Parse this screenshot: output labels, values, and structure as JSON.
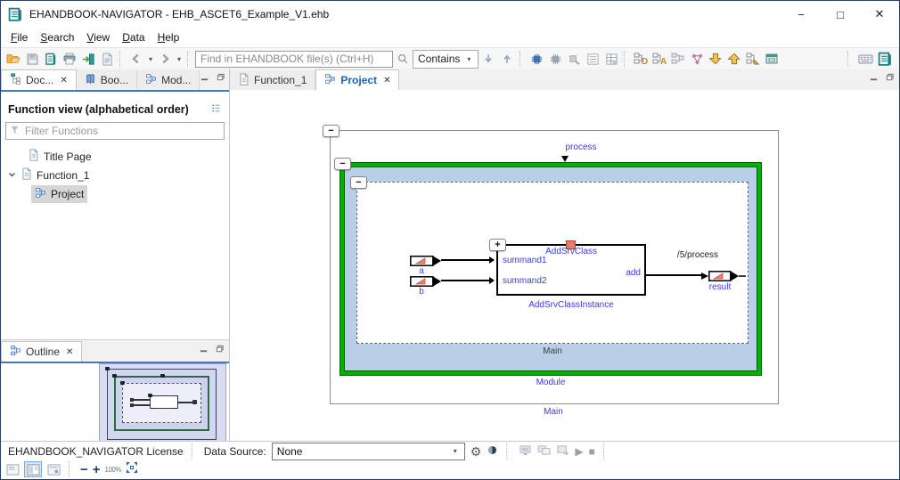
{
  "window": {
    "title": "EHANDBOOK-NAVIGATOR - EHB_ASCET6_Example_V1.ehb"
  },
  "icons": {
    "minimize": "−",
    "maximize": "□",
    "close": "✕",
    "tab_close": "✕",
    "caret_down": "▾",
    "collapse": "−",
    "expand": "+",
    "gear": "⚙",
    "play": "▶",
    "stop": "■",
    "minus": "−",
    "plus": "+"
  },
  "menu": {
    "items": [
      "File",
      "Search",
      "View",
      "Data",
      "Help"
    ]
  },
  "toolbar": {
    "find_placeholder": "Find in EHANDBOOK file(s) (Ctrl+H)",
    "match_mode": "Contains"
  },
  "left_panel": {
    "tabs": [
      {
        "label": "Doc..."
      },
      {
        "label": "Boo..."
      },
      {
        "label": "Mod..."
      }
    ],
    "function_view": {
      "title": "Function view (alphabetical order)",
      "filter_placeholder": "Filter Functions",
      "tree": [
        {
          "label": "Title Page"
        },
        {
          "label": "Function_1"
        },
        {
          "label": "Project"
        }
      ]
    },
    "outline": {
      "title": "Outline"
    }
  },
  "main": {
    "tabs": [
      {
        "label": "Function_1"
      },
      {
        "label": "Project"
      }
    ]
  },
  "diagram": {
    "top_port_label": "process",
    "root_label": "Main",
    "module_label": "Module",
    "inner_label": "Main",
    "wire_label": "/5/process",
    "port_a": "a",
    "port_b": "b",
    "port_result": "result",
    "block": {
      "class_name": "AddSrvClass",
      "instance_name": "AddSrvClassInstance",
      "input1": "summand1",
      "input2": "summand2",
      "output": "add"
    },
    "colors": {
      "module_fill": "#b9cfe8",
      "module_border": "#00b200",
      "label_blue": "#3a3af0",
      "marker_red": "#ed7a62"
    }
  },
  "statusbar": {
    "license": "EHANDBOOK_NAVIGATOR License",
    "data_source_label": "Data Source:",
    "data_source_value": "None",
    "zoom_level": "100%"
  }
}
